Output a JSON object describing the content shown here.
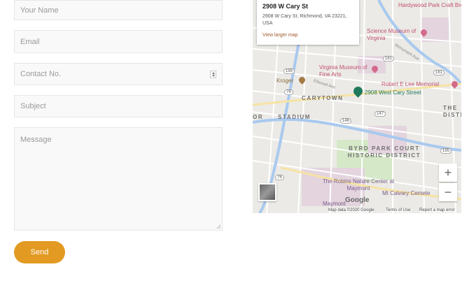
{
  "form": {
    "name_placeholder": "Your Name",
    "email_placeholder": "Email",
    "contact_placeholder": "Contact No.",
    "subject_placeholder": "Subject",
    "message_placeholder": "Message",
    "send_label": "Send"
  },
  "colors": {
    "accent": "#e29a22",
    "field_bg": "#f9f9f9",
    "pin": "#1f7a5c"
  },
  "map": {
    "info": {
      "title": "2908 W Cary St",
      "address": "2908 W Cary St, Richmond, VA 23221, USA",
      "link": "View larger map"
    },
    "labels": {
      "hardywood": "Hardywood Park Craft Brewery - Richmond",
      "science_museum": "Science Museum of Virginia",
      "vmfa": "Virginia Museum of Fine Arts",
      "robert_e_lee": "Robert E Lee Memorial",
      "kroger": "Kroger",
      "carytown": "CARYTOWN",
      "stadium": "STADIUM",
      "pin_label": "2908 West Cary Street",
      "byrd_park": "BYRD PARK COURT HISTORIC DISTRICT",
      "robins": "The Robins Nature Center at Maymont",
      "mt_calvary": "Mt Calvary Cemete",
      "maymont": "Maymont",
      "the_dist": "THE DISTR",
      "or": "OR",
      "monument": "Monument Ave",
      "ellwood": "Ellwood Ave"
    },
    "roads": [
      "195",
      "161",
      "147",
      "146",
      "76",
      "195",
      "76",
      "161"
    ],
    "footer": {
      "data": "Map data ©2020 Google",
      "terms": "Terms of Use",
      "report": "Report a map error"
    },
    "google": "Google"
  }
}
